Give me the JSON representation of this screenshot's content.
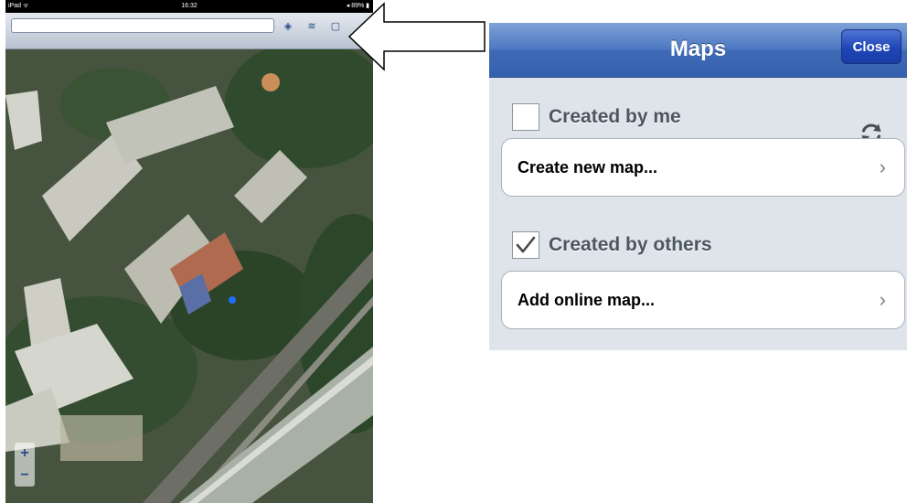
{
  "ipad": {
    "status": {
      "carrier": "iPad ᯤ",
      "time": "16:32",
      "battery": "◂ 89% ▮"
    },
    "search_value": "",
    "toolbar_icons": [
      "locate-icon",
      "layers-icon",
      "page-icon"
    ],
    "zoom": {
      "in": "+",
      "out": "−"
    }
  },
  "panel": {
    "title": "Maps",
    "close_label": "Close",
    "sections": [
      {
        "label": "Created by me",
        "checked": false,
        "row_label": "Create new map..."
      },
      {
        "label": "Created by others",
        "checked": true,
        "row_label": "Add online map..."
      }
    ],
    "chevron": "›"
  },
  "colors": {
    "navbar": "#4e79c2",
    "close_button": "#1f46b8",
    "panel_bg": "#dfe4ea"
  }
}
